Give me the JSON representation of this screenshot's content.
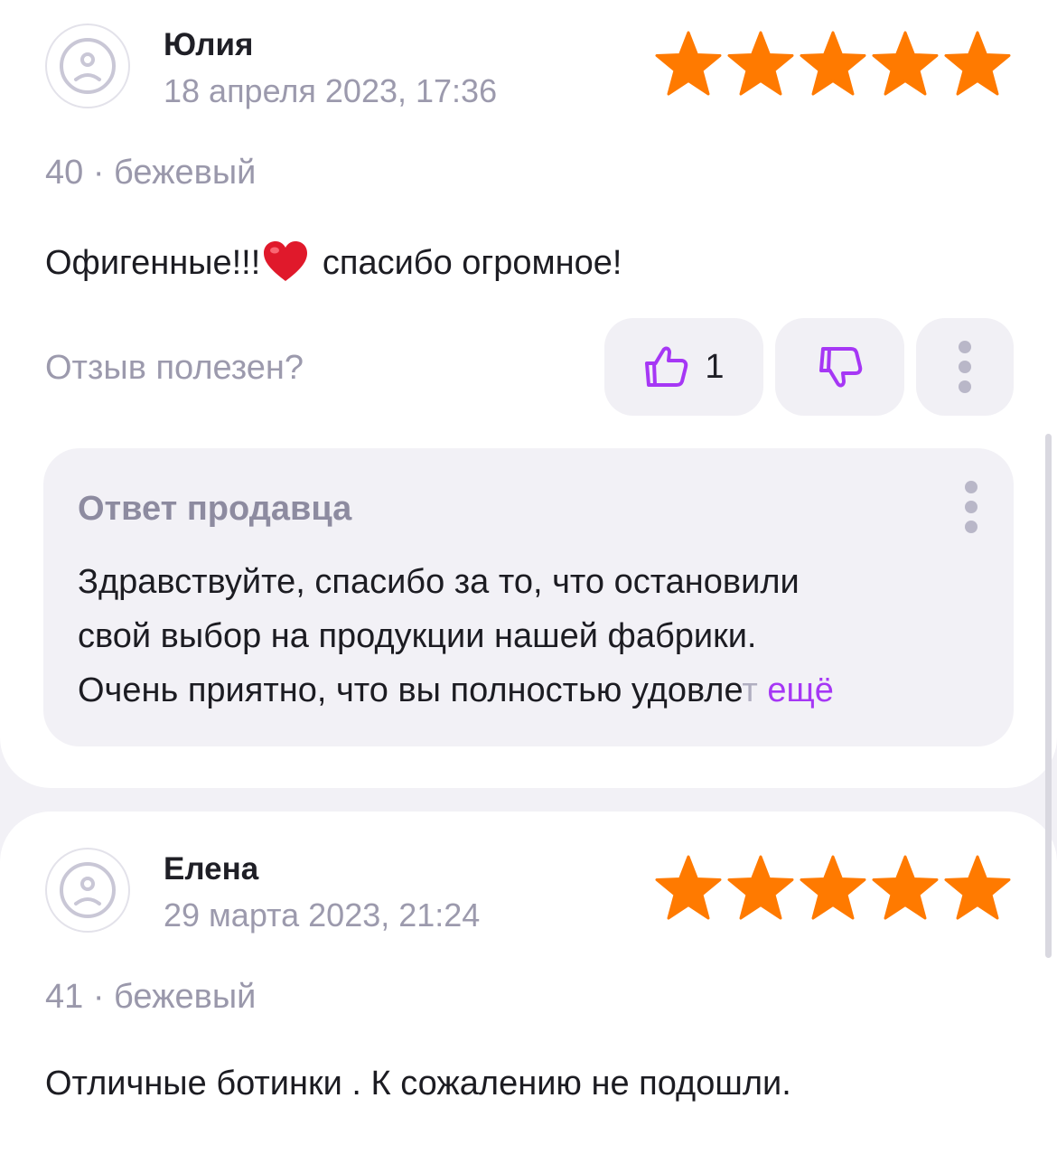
{
  "reviews": [
    {
      "author": "Юлия",
      "date": "18 апреля 2023, 17:36",
      "rating": 5,
      "variant": "40 · бежевый",
      "text_before_emoji": "Офигенные!!!",
      "emoji": "heart-emoji",
      "text_after_emoji": " спасибо огромное!",
      "helpful_label": "Отзыв полезен?",
      "like_count": "1",
      "seller_reply": {
        "title": "Ответ продавца",
        "line1": "Здравствуйте, спасибо за то, что остановили",
        "line2": "свой выбор на продукции нашей фабрики.",
        "line3": "Очень приятно, что вы полностью удовле",
        "line3_fade": "т",
        "more_link": "ещё"
      }
    },
    {
      "author": "Елена",
      "date": "29 марта 2023, 21:24",
      "rating": 5,
      "variant": "41 · бежевый",
      "text": "Отличные ботинки . К сожалению не подошли."
    }
  ],
  "colors": {
    "star": "#ff7a00",
    "accent": "#a637f5",
    "muted_text": "#9c9aad",
    "button_bg": "#f1f0f5",
    "page_bg": "#f2f1f6"
  },
  "icons": {
    "avatar": "sad-face-icon",
    "star": "star-icon",
    "like": "thumbs-up-icon",
    "dislike": "thumbs-down-icon",
    "more": "more-vertical-icon"
  }
}
